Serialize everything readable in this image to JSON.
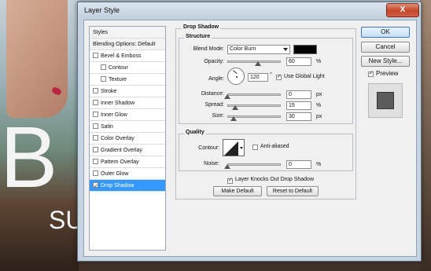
{
  "dialog": {
    "title": "Layer Style",
    "close_label": "X"
  },
  "styles_list": [
    {
      "label": "Styles",
      "type": "header"
    },
    {
      "label": "Blending Options: Default",
      "type": "header"
    },
    {
      "label": "Bevel & Emboss",
      "checked": false
    },
    {
      "label": "Contour",
      "checked": false,
      "sub": true
    },
    {
      "label": "Texture",
      "checked": false,
      "sub": true
    },
    {
      "label": "Stroke",
      "checked": false
    },
    {
      "label": "Inner Shadow",
      "checked": false
    },
    {
      "label": "Inner Glow",
      "checked": false
    },
    {
      "label": "Satin",
      "checked": false
    },
    {
      "label": "Color Overlay",
      "checked": false
    },
    {
      "label": "Gradient Overlay",
      "checked": false
    },
    {
      "label": "Pattern Overlay",
      "checked": false
    },
    {
      "label": "Outer Glow",
      "checked": false
    },
    {
      "label": "Drop Shadow",
      "checked": true,
      "selected": true
    }
  ],
  "drop_shadow": {
    "section_title": "Drop Shadow",
    "structure_title": "Structure",
    "blend_mode_label": "Blend Mode:",
    "blend_mode_value": "Color Burn",
    "shadow_color": "#000000",
    "opacity_label": "Opacity:",
    "opacity_value": "60",
    "opacity_unit": "%",
    "angle_label": "Angle:",
    "angle_value": "120",
    "angle_unit": "°",
    "global_light_label": "Use Global Light",
    "global_light_checked": true,
    "distance_label": "Distance:",
    "distance_value": "0",
    "distance_unit": "px",
    "spread_label": "Spread:",
    "spread_value": "15",
    "spread_unit": "%",
    "size_label": "Size:",
    "size_value": "30",
    "size_unit": "px",
    "quality_title": "Quality",
    "contour_label": "Contour:",
    "anti_aliased_label": "Anti-aliased",
    "anti_aliased_checked": false,
    "noise_label": "Noise:",
    "noise_value": "0",
    "noise_unit": "%",
    "knocks_out_label": "Layer Knocks Out Drop Shadow",
    "knocks_out_checked": true,
    "make_default_label": "Make Default",
    "reset_default_label": "Reset to Default"
  },
  "slider_levels": {
    "opacity": 0.6,
    "distance": 0,
    "spread": 0.15,
    "size": 0.12,
    "noise": 0
  },
  "right_panel": {
    "ok_label": "OK",
    "cancel_label": "Cancel",
    "new_style_label": "New Style...",
    "preview_label": "Preview",
    "preview_checked": true
  },
  "background": {
    "letter_big": "B",
    "letter_small": "SU"
  }
}
